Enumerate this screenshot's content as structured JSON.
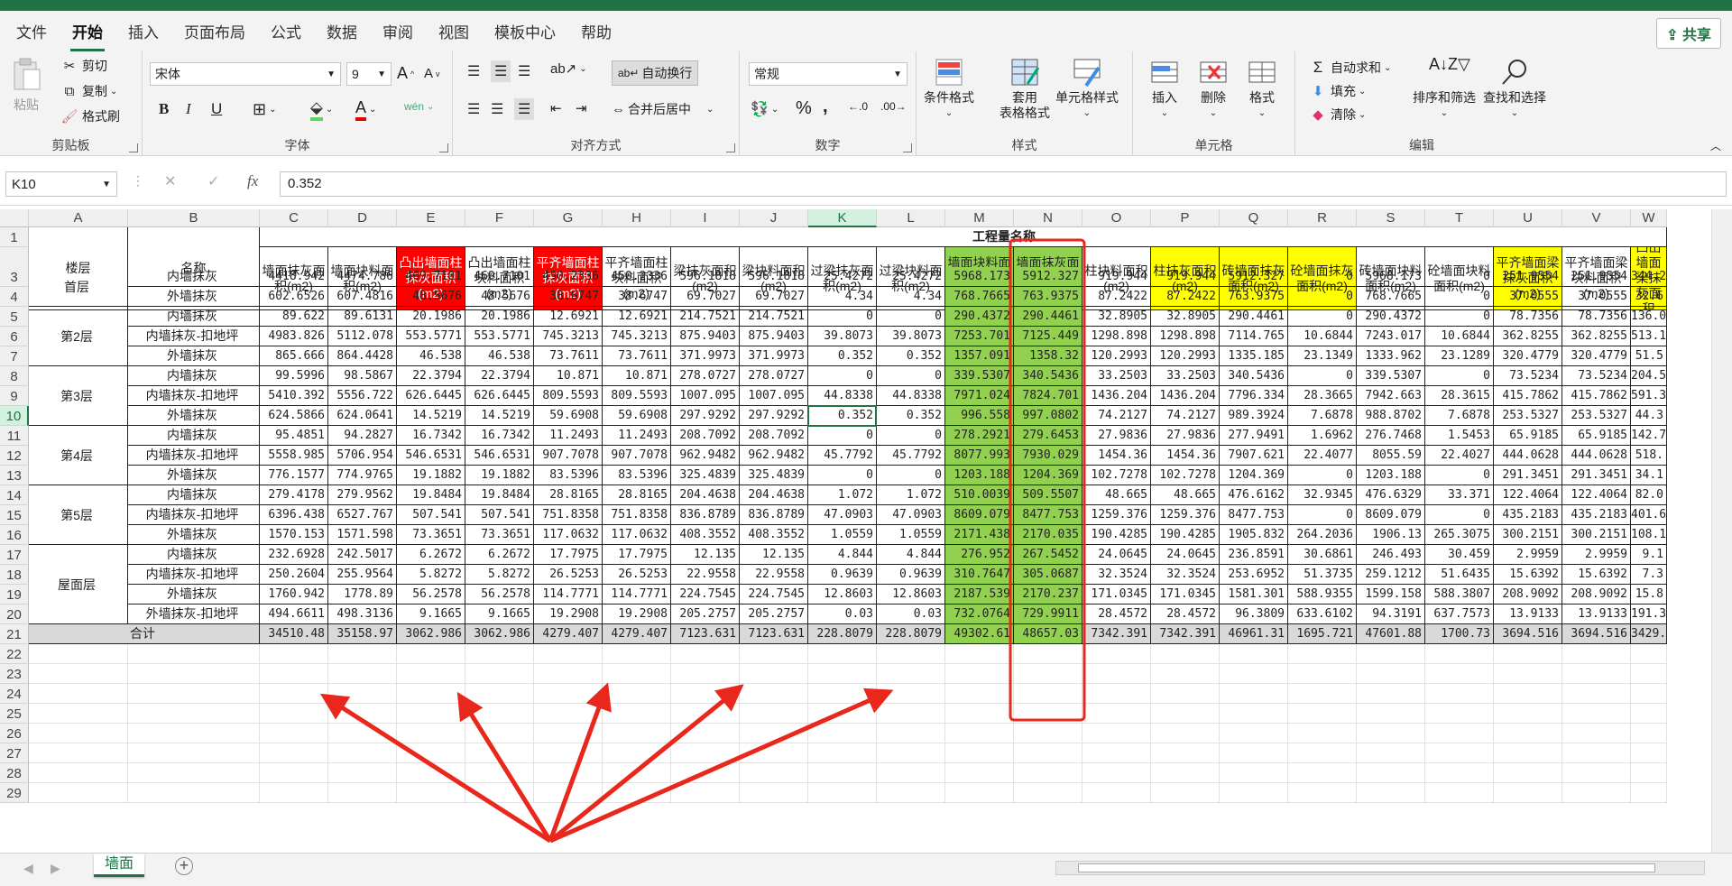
{
  "menu": {
    "items": [
      "文件",
      "开始",
      "插入",
      "页面布局",
      "公式",
      "数据",
      "审阅",
      "视图",
      "模板中心",
      "帮助"
    ],
    "active": "开始",
    "share": "共享"
  },
  "ribbon": {
    "clipboard": {
      "paste": "粘贴",
      "cut": "剪切",
      "copy": "复制",
      "format_painter": "格式刷",
      "label": "剪贴板"
    },
    "font": {
      "name": "宋体",
      "size": "9",
      "label": "字体",
      "bold": "B",
      "italic": "I",
      "underline": "U"
    },
    "alignment": {
      "wrap": "自动换行",
      "merge": "合并后居中",
      "label": "对齐方式"
    },
    "number": {
      "format": "常规",
      "label": "数字",
      "percent": "%",
      "comma": ","
    },
    "styles": {
      "conditional": "条件格式",
      "table_format": "套用\n表格格式",
      "cell_style": "单元格样式",
      "label": "样式"
    },
    "cells": {
      "insert": "插入",
      "delete": "删除",
      "format": "格式",
      "label": "单元格"
    },
    "editing": {
      "autosum": "自动求和",
      "fill": "填充",
      "clear": "清除",
      "sort": "排序和筛选",
      "find": "查找和选择",
      "label": "编辑"
    }
  },
  "formula_bar": {
    "name_box": "K10",
    "fx": "fx",
    "value": "0.352"
  },
  "sheet": {
    "columns": [
      "A",
      "B",
      "C",
      "D",
      "E",
      "F",
      "G",
      "H",
      "I",
      "J",
      "K",
      "L",
      "M",
      "N",
      "O",
      "P",
      "Q",
      "R",
      "S",
      "T",
      "U",
      "V",
      "W"
    ],
    "selected_col": "K",
    "selected_row": 10,
    "rows": [
      1,
      2,
      3,
      4,
      5,
      6,
      7,
      8,
      9,
      10,
      11,
      12,
      13,
      14,
      15,
      16,
      17,
      18,
      19,
      20,
      21,
      22,
      23,
      24,
      25,
      26,
      27,
      28,
      29
    ],
    "title": "工程量名称",
    "floor_header": "楼层",
    "name_header": "名称",
    "headers": [
      "墙面抹灰面积(m2)",
      "墙面块料面积(m2)",
      "凸出墙面柱抹灰面积(m2)",
      "凸出墙面柱块料面积(m2)",
      "平齐墙面柱抹灰面积(m2)",
      "平齐墙面柱块料面积(m2)",
      "梁抹灰面积(m2)",
      "梁块料面积(m2)",
      "过梁抹灰面积(m2)",
      "过梁块料面积(m2)",
      "墙面块料面积（不分材质）(m2)",
      "墙面抹灰面积（不分材质）(m2)",
      "柱块料面积(m2)",
      "柱抹灰面积(m2)",
      "砖墙面抹灰面积(m2)",
      "砼墙面抹灰面积(m2)",
      "砖墙面块料面积(m2)",
      "砼墙面块料面积(m2)",
      "平齐墙面梁抹灰面积(m2)",
      "平齐墙面梁块料面积(m2)",
      "凸出墙面梁抹灰面积"
    ],
    "header_styles": [
      "",
      "",
      "red",
      "",
      "red",
      "",
      "",
      "",
      "",
      "",
      "green",
      "green",
      "",
      "yellow",
      "yellow",
      "yellow",
      "",
      "",
      "yellow",
      "",
      "yellow"
    ],
    "floors": [
      {
        "name": "首层",
        "rows": 2
      },
      {
        "name": "第2层",
        "rows": 3
      },
      {
        "name": "第3层",
        "rows": 3
      },
      {
        "name": "第4层",
        "rows": 3
      },
      {
        "name": "第5层",
        "rows": 3
      },
      {
        "name": "屋面层",
        "rows": 4
      }
    ],
    "data": [
      [
        "内墙抹灰",
        "4418.942",
        "4474.786",
        "469.7101",
        "469.7101",
        "450.2336",
        "450.2336",
        "596.1818",
        "596.1818",
        "25.4272",
        "25.4272",
        "5968.173",
        "5912.327",
        "919.944",
        "919.944",
        "5912.327",
        "0",
        "5968.173",
        "0",
        "251.9554",
        "251.9554",
        "344.2"
      ],
      [
        "外墙抹灰",
        "602.6526",
        "607.4816",
        "48.5676",
        "48.5676",
        "38.6747",
        "38.6747",
        "69.7027",
        "69.7027",
        "4.34",
        "4.34",
        "768.7665",
        "763.9375",
        "87.2422",
        "87.2422",
        "763.9375",
        "0",
        "768.7665",
        "0",
        "37.0555",
        "37.0555",
        "32.6"
      ],
      [
        "内墙抹灰",
        "89.622",
        "89.6131",
        "20.1986",
        "20.1986",
        "12.6921",
        "12.6921",
        "214.7521",
        "214.7521",
        "0",
        "0",
        "290.4372",
        "290.4461",
        "32.8905",
        "32.8905",
        "290.4461",
        "0",
        "290.4372",
        "0",
        "78.7356",
        "78.7356",
        "136.0"
      ],
      [
        "内墙抹灰-扣地坪",
        "4983.826",
        "5112.078",
        "553.5771",
        "553.5771",
        "745.3213",
        "745.3213",
        "875.9403",
        "875.9403",
        "39.8073",
        "39.8073",
        "7253.701",
        "7125.449",
        "1298.898",
        "1298.898",
        "7114.765",
        "10.6844",
        "7243.017",
        "10.6844",
        "362.8255",
        "362.8255",
        "513.1"
      ],
      [
        "外墙抹灰",
        "865.666",
        "864.4428",
        "46.538",
        "46.538",
        "73.7611",
        "73.7611",
        "371.9973",
        "371.9973",
        "0.352",
        "0.352",
        "1357.091",
        "1358.32",
        "120.2993",
        "120.2993",
        "1335.185",
        "23.1349",
        "1333.962",
        "23.1289",
        "320.4779",
        "320.4779",
        "51.5"
      ],
      [
        "内墙抹灰",
        "99.5996",
        "98.5867",
        "22.3794",
        "22.3794",
        "10.871",
        "10.871",
        "278.0727",
        "278.0727",
        "0",
        "0",
        "339.5307",
        "340.5436",
        "33.2503",
        "33.2503",
        "340.5436",
        "0",
        "339.5307",
        "0",
        "73.5234",
        "73.5234",
        "204.5"
      ],
      [
        "内墙抹灰-扣地坪",
        "5410.392",
        "5556.722",
        "626.6445",
        "626.6445",
        "809.5593",
        "809.5593",
        "1007.095",
        "1007.095",
        "44.8338",
        "44.8338",
        "7971.024",
        "7824.701",
        "1436.204",
        "1436.204",
        "7796.334",
        "28.3665",
        "7942.663",
        "28.3615",
        "415.7862",
        "415.7862",
        "591.3"
      ],
      [
        "外墙抹灰",
        "624.5866",
        "624.0641",
        "14.5219",
        "14.5219",
        "59.6908",
        "59.6908",
        "297.9292",
        "297.9292",
        "0.352",
        "0.352",
        "996.558",
        "997.0802",
        "74.2127",
        "74.2127",
        "989.3924",
        "7.6878",
        "988.8702",
        "7.6878",
        "253.5327",
        "253.5327",
        "44.3"
      ],
      [
        "内墙抹灰",
        "95.4851",
        "94.2827",
        "16.7342",
        "16.7342",
        "11.2493",
        "11.2493",
        "208.7092",
        "208.7092",
        "0",
        "0",
        "278.2921",
        "279.6453",
        "27.9836",
        "27.9836",
        "277.9491",
        "1.6962",
        "276.7468",
        "1.5453",
        "65.9185",
        "65.9185",
        "142.7"
      ],
      [
        "内墙抹灰-扣地坪",
        "5558.985",
        "5706.954",
        "546.6531",
        "546.6531",
        "907.7078",
        "907.7078",
        "962.9482",
        "962.9482",
        "45.7792",
        "45.7792",
        "8077.993",
        "7930.029",
        "1454.36",
        "1454.36",
        "7907.621",
        "22.4077",
        "8055.59",
        "22.4027",
        "444.0628",
        "444.0628",
        "518."
      ],
      [
        "外墙抹灰",
        "776.1577",
        "774.9765",
        "19.1882",
        "19.1882",
        "83.5396",
        "83.5396",
        "325.4839",
        "325.4839",
        "0",
        "0",
        "1203.188",
        "1204.369",
        "102.7278",
        "102.7278",
        "1204.369",
        "0",
        "1203.188",
        "0",
        "291.3451",
        "291.3451",
        "34.1"
      ],
      [
        "内墙抹灰",
        "279.4178",
        "279.9562",
        "19.8484",
        "19.8484",
        "28.8165",
        "28.8165",
        "204.4638",
        "204.4638",
        "1.072",
        "1.072",
        "510.0039",
        "509.5507",
        "48.665",
        "48.665",
        "476.6162",
        "32.9345",
        "476.6329",
        "33.371",
        "122.4064",
        "122.4064",
        "82.0"
      ],
      [
        "内墙抹灰-扣地坪",
        "6396.438",
        "6527.767",
        "507.541",
        "507.541",
        "751.8358",
        "751.8358",
        "836.8789",
        "836.8789",
        "47.0903",
        "47.0903",
        "8609.079",
        "8477.753",
        "1259.376",
        "1259.376",
        "8477.753",
        "0",
        "8609.079",
        "0",
        "435.2183",
        "435.2183",
        "401.6"
      ],
      [
        "外墙抹灰",
        "1570.153",
        "1571.598",
        "73.3651",
        "73.3651",
        "117.0632",
        "117.0632",
        "408.3552",
        "408.3552",
        "1.0559",
        "1.0559",
        "2171.438",
        "2170.035",
        "190.4285",
        "190.4285",
        "1905.832",
        "264.2036",
        "1906.13",
        "265.3075",
        "300.2151",
        "300.2151",
        "108.1"
      ],
      [
        "内墙抹灰",
        "232.6928",
        "242.5017",
        "6.2672",
        "6.2672",
        "17.7975",
        "17.7975",
        "12.135",
        "12.135",
        "4.844",
        "4.844",
        "276.952",
        "267.5452",
        "24.0645",
        "24.0645",
        "236.8591",
        "30.6861",
        "246.493",
        "30.459",
        "2.9959",
        "2.9959",
        "9.1"
      ],
      [
        "内墙抹灰-扣地坪",
        "250.2604",
        "255.9564",
        "5.8272",
        "5.8272",
        "26.5253",
        "26.5253",
        "22.9558",
        "22.9558",
        "0.9639",
        "0.9639",
        "310.7647",
        "305.0687",
        "32.3524",
        "32.3524",
        "253.6952",
        "51.3735",
        "259.1212",
        "51.6435",
        "15.6392",
        "15.6392",
        "7.3"
      ],
      [
        "外墙抹灰",
        "1760.942",
        "1778.89",
        "56.2578",
        "56.2578",
        "114.7771",
        "114.7771",
        "224.7545",
        "224.7545",
        "12.8603",
        "12.8603",
        "2187.539",
        "2170.237",
        "171.0345",
        "171.0345",
        "1581.301",
        "588.9355",
        "1599.158",
        "588.3807",
        "208.9092",
        "208.9092",
        "15.8"
      ],
      [
        "外墙抹灰-扣地坪",
        "494.6611",
        "498.3136",
        "9.1665",
        "9.1665",
        "19.2908",
        "19.2908",
        "205.2757",
        "205.2757",
        "0.03",
        "0.03",
        "732.0764",
        "729.9911",
        "28.4572",
        "28.4572",
        "96.3809",
        "633.6102",
        "94.3191",
        "637.7573",
        "13.9133",
        "13.9133",
        "191.3"
      ]
    ],
    "total_label": "合计",
    "totals": [
      "34510.48",
      "35158.97",
      "3062.986",
      "3062.986",
      "4279.407",
      "4279.407",
      "7123.631",
      "7123.631",
      "228.8079",
      "228.8079",
      "49302.61",
      "48657.03",
      "7342.391",
      "7342.391",
      "46961.31",
      "1695.721",
      "47601.88",
      "1700.73",
      "3694.516",
      "3694.516",
      "3429."
    ],
    "tab": "墙面"
  },
  "colors": {
    "accent": "#217346",
    "highlight_box": "#e8281c",
    "arrows": "#e8281c"
  }
}
